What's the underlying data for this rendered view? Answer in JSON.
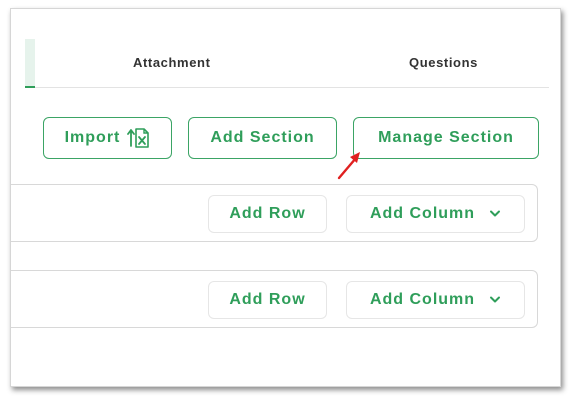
{
  "tabs": [
    {
      "label": "Attachment"
    },
    {
      "label": "Questions"
    }
  ],
  "toolbar": {
    "import_label": "Import",
    "add_section_label": "Add Section",
    "manage_section_label": "Manage Section"
  },
  "sections": [
    {
      "add_row_label": "Add Row",
      "add_column_label": "Add Column"
    },
    {
      "add_row_label": "Add Row",
      "add_column_label": "Add Column"
    }
  ],
  "colors": {
    "accent": "#2f9e5a",
    "annotation_arrow": "#e02020"
  },
  "icons": {
    "import": "excel-upload-icon",
    "dropdown": "chevron-down-icon",
    "annotation": "red-arrow-icon"
  }
}
